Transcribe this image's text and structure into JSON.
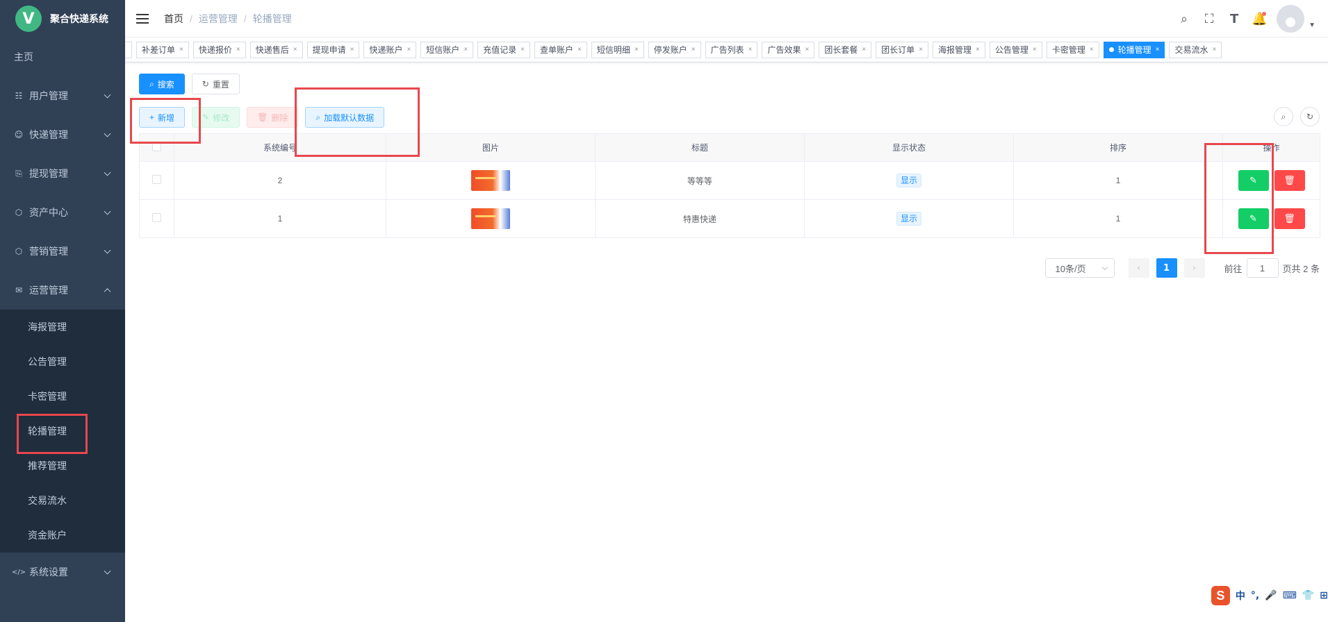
{
  "app": {
    "title": "聚合快递系统",
    "logo_letter": "V"
  },
  "sidebar": {
    "home": "主页",
    "menus": [
      {
        "label": "用户管理",
        "icon": "☷"
      },
      {
        "label": "快递管理",
        "icon": "☺"
      },
      {
        "label": "提现管理",
        "icon": "⎘"
      },
      {
        "label": "资产中心",
        "icon": "⬡"
      },
      {
        "label": "营销管理",
        "icon": "⬡"
      },
      {
        "label": "运营管理",
        "icon": "✉"
      }
    ],
    "submenu": [
      "海报管理",
      "公告管理",
      "卡密管理",
      "轮播管理",
      "推荐管理",
      "交易流水",
      "资金账户"
    ],
    "settings": {
      "label": "系统设置",
      "icon": "</>"
    }
  },
  "breadcrumb": [
    "首页",
    "运营管理",
    "轮播管理"
  ],
  "tags": [
    "补差订单",
    "快递报价",
    "快递售后",
    "提现申请",
    "快递账户",
    "短信账户",
    "充值记录",
    "查单账户",
    "短信明细",
    "停发账户",
    "广告列表",
    "广告效果",
    "团长套餐",
    "团长订单",
    "海报管理",
    "公告管理",
    "卡密管理",
    "轮播管理",
    "交易流水"
  ],
  "tag_close": "×",
  "toolbar": {
    "search": "搜索",
    "reset": "重置",
    "add": "新增",
    "edit": "修改",
    "delete": "删除",
    "load_default": "加载默认数据"
  },
  "table": {
    "headers": [
      "系统编号",
      "图片",
      "标题",
      "显示状态",
      "排序",
      "操作"
    ],
    "rows": [
      {
        "id": "2",
        "title": "等等等",
        "status": "显示",
        "sort": "1"
      },
      {
        "id": "1",
        "title": "特惠快递",
        "status": "显示",
        "sort": "1"
      }
    ]
  },
  "pagination": {
    "page_size": "10条/页",
    "current": "1",
    "goto_prefix": "前往",
    "goto_value": "1",
    "goto_suffix": "页",
    "total": "共 2 条"
  },
  "ime": {
    "logo": "S",
    "items": [
      "中",
      "°,",
      "🎤",
      "⌨",
      "👕",
      "⊞"
    ]
  },
  "colors": {
    "primary": "#1890ff",
    "sidebar": "#304156",
    "submenu": "#1f2d3d",
    "success": "#13ce66",
    "danger": "#ff4949",
    "highlight": "#e8474d"
  }
}
